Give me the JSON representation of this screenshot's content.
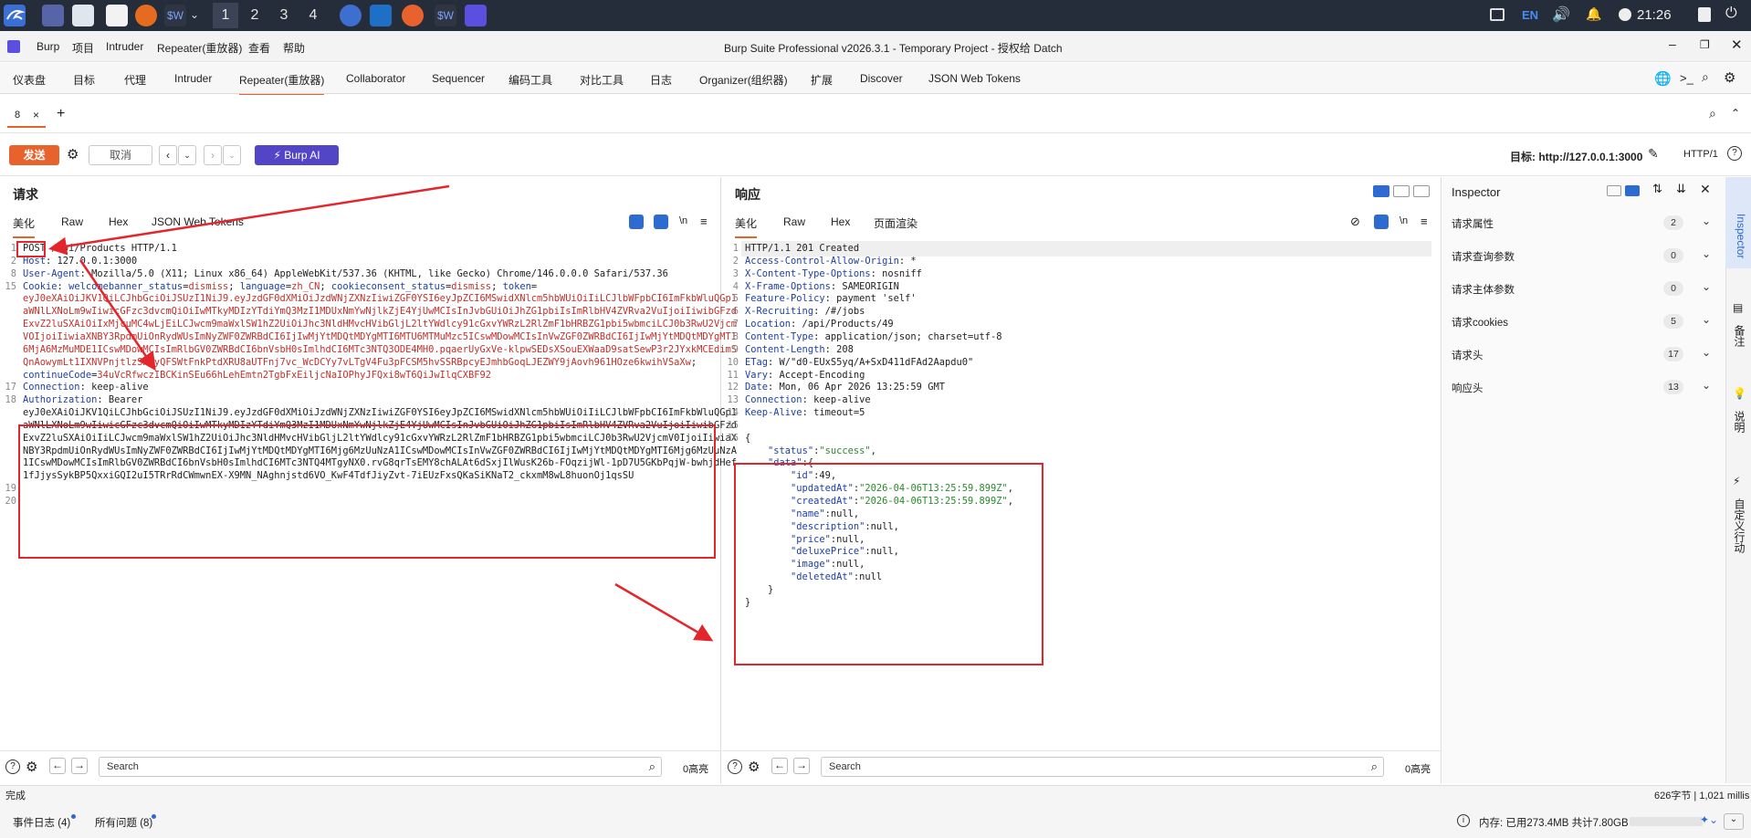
{
  "taskbar": {
    "workspaces": [
      "1",
      "2",
      "3",
      "4"
    ],
    "tray": {
      "lang": "EN",
      "clock": "21:26"
    }
  },
  "app": {
    "menu": [
      "Burp",
      "项目",
      "Intruder",
      "Repeater(重放器)",
      "查看",
      "帮助"
    ],
    "title": "Burp Suite Professional v2026.3.1 - Temporary Project - 授权给 Datch"
  },
  "main_tabs": [
    "仪表盘",
    "目标",
    "代理",
    "Intruder",
    "Repeater(重放器)",
    "Collaborator",
    "Sequencer",
    "编码工具",
    "对比工具",
    "日志",
    "Organizer(组织器)",
    "扩展",
    "Discover",
    "JSON Web Tokens"
  ],
  "sub_tab": {
    "label": "8",
    "close": "×",
    "add": "+"
  },
  "toolbar": {
    "send": "发送",
    "cancel": "取消",
    "burp_ai": "Burp AI",
    "target_label": "目标: http://127.0.0.1:3000",
    "http_version": "HTTP/1"
  },
  "request": {
    "title": "请求",
    "tabs": [
      "美化",
      "Raw",
      "Hex",
      "JSON Web Tokens"
    ],
    "newline_btn": "\\n",
    "lines": [
      {
        "n": "1",
        "segs": [
          [
            "v",
            "POST /api/Products HTTP/1.1"
          ]
        ]
      },
      {
        "n": "2",
        "segs": [
          [
            "k",
            "Host"
          ],
          [
            "v",
            ": 127.0.0.1:3000"
          ]
        ]
      },
      {
        "n": "8",
        "segs": [
          [
            "k",
            "User-Agent"
          ],
          [
            "v",
            ": Mozilla/5.0 (X11; Linux x86_64) AppleWebKit/537.36 (KHTML, like Gecko) Chrome/146.0.0.0 Safari/537.36"
          ]
        ]
      },
      {
        "n": "15",
        "segs": [
          [
            "k",
            "Cookie"
          ],
          [
            "v",
            ": "
          ],
          [
            "blue",
            "welcomebanner_status"
          ],
          [
            "v",
            "="
          ],
          [
            "red",
            "dismiss"
          ],
          [
            "v",
            "; "
          ],
          [
            "blue",
            "language"
          ],
          [
            "v",
            "="
          ],
          [
            "red",
            "zh_CN"
          ],
          [
            "v",
            "; "
          ],
          [
            "blue",
            "cookieconsent_status"
          ],
          [
            "v",
            "="
          ],
          [
            "red",
            "dismiss"
          ],
          [
            "v",
            "; "
          ],
          [
            "blue",
            "token"
          ],
          [
            "v",
            "="
          ]
        ]
      },
      {
        "n": "",
        "segs": [
          [
            "red",
            "eyJ0eXAiOiJKV1QiLCJhbGciOiJSUzI1NiJ9.eyJzdGF0dXMiOiJzdWNjZXNzIiwiZGF0YSI6eyJpZCI6MSwidXNlcm5hbWUiOiIiLCJlbWFpbCI6ImFkbWluQGp1"
          ]
        ]
      },
      {
        "n": "",
        "segs": [
          [
            "red",
            "aWNlLXNoLm9wIiwicGFzc3dvcmQiOiIwMTkyMDIzYTdiYmQ3MzI1MDUxNmYwNjlkZjE4YjUwMCIsInJvbGUiOiJhZG1pbiIsImRlbHV4ZVRva2VuIjoiIiwibGFzd"
          ]
        ]
      },
      {
        "n": "",
        "segs": [
          [
            "red",
            "ExvZ2luSXAiOiIxMjcuMC4wLjEiLCJwcm9maWxlSW1hZ2UiOiJhc3NldHMvcHVibGljL2ltYWdlcy91cGxvYWRzL2RlZmF1bHRBZG1pbi5wbmciLCJ0b3RwU2Vjcm"
          ]
        ]
      },
      {
        "n": "",
        "segs": [
          [
            "red",
            "VOIjoiIiwiaXNBY3RpdmUiOnRydWUsImNyZWF0ZWRBdCI6IjIwMjYtMDQtMDYgMTI6MTU6MTMuMzc5ICswMDowMCIsInVwZGF0ZWRBdCI6IjIwMjYtMDQtMDYgMTI"
          ]
        ]
      },
      {
        "n": "",
        "segs": [
          [
            "red",
            "6MjA6MzMuMDE1ICswMDowMCIsImRlbGV0ZWRBdCI6bnVsbH0sImlhdCI6MTc3NTQ3ODE4MH0.pqaerUyGxVe-klpwSEDsXSouEXWaaD9satSewP3r2JYxkMCEdimS"
          ]
        ]
      },
      {
        "n": "",
        "segs": [
          [
            "red",
            "QnAowymLt1IXNVPnjtlzSKAyQFSWtFnkPtdXRU8aUTFnj7vc_WcDCYy7vLTgV4Fu3pFCSM5hvSSRBpcyEJmhbGoqLJEZWY9jAovh961HOze6kwihVSaXw"
          ],
          [
            "v",
            "; "
          ]
        ]
      },
      {
        "n": "",
        "segs": [
          [
            "blue",
            "continueCode"
          ],
          [
            "v",
            "="
          ],
          [
            "red",
            "34uVcRfwczIBCKinSEu66hLehEmtn2TgbFxEiljcNaIOPhyJFQxi8wT6QiJwIlqCXBF92"
          ]
        ]
      },
      {
        "n": "17",
        "segs": [
          [
            "k",
            "Connection"
          ],
          [
            "v",
            ": keep-alive"
          ]
        ]
      },
      {
        "n": "18",
        "segs": [
          [
            "k",
            "Authorization"
          ],
          [
            "v",
            ": Bearer"
          ]
        ]
      },
      {
        "n": "",
        "segs": [
          [
            "v",
            "eyJ0eXAiOiJKV1QiLCJhbGciOiJSUzI1NiJ9.eyJzdGF0dXMiOiJzdWNjZXNzIiwiZGF0YSI6eyJpZCI6MSwidXNlcm5hbWUiOiIiLCJlbWFpbCI6ImFkbWluQGp1"
          ]
        ]
      },
      {
        "n": "",
        "segs": [
          [
            "v",
            "aWNlLXNoLm9wIiwicGFzc3dvcmQiOiIwMTkyMDIzYTdiYmQ3MzI1MDUxNmYwNjlkZjE4YjUwMCIsInJvbGUiOiJhZG1pbiIsImRlbHV4ZVRva2VuIjoiIiwibGFzd"
          ]
        ]
      },
      {
        "n": "",
        "segs": [
          [
            "v",
            "ExvZ2luSXAiOiIiLCJwcm9maWxlSW1hZ2UiOiJhc3NldHMvcHVibGljL2ltYWdlcy91cGxvYWRzL2RlZmF1bHRBZG1pbi5wbmciLCJ0b3RwU2VjcmV0IjoiIiwiaX"
          ]
        ]
      },
      {
        "n": "",
        "segs": [
          [
            "v",
            "NBY3RpdmUiOnRydWUsImNyZWF0ZWRBdCI6IjIwMjYtMDQtMDYgMTI6Mjg6MzUuNzA1ICswMDowMCIsInVwZGF0ZWRBdCI6IjIwMjYtMDQtMDYgMTI6Mjg6MzUuNzA"
          ]
        ]
      },
      {
        "n": "",
        "segs": [
          [
            "v",
            "1ICswMDowMCIsImRlbGV0ZWRBdCI6bnVsbH0sImlhdCI6MTc3NTQ4MTgyNX0.rvG8qrTsEMY8chALAt6dSxjIlWusK26b-FOqzijWl-1pD7U5GKbPqjW-bwhjdHef"
          ]
        ]
      },
      {
        "n": "",
        "segs": [
          [
            "v",
            "1fJjysSykBP5QxxiGQI2uI5TRrRdCWmwnEX-X9MN_NAghnjstd6VO_KwF4TdfJiyZvt-7iEUzFxsQKaSiKNaT2_ckxmM8wL8huonOj1qsSU"
          ]
        ]
      },
      {
        "n": "19",
        "segs": []
      },
      {
        "n": "20",
        "segs": []
      }
    ],
    "search_placeholder": "Search",
    "highlight_count": "0高亮"
  },
  "response": {
    "title": "响应",
    "tabs": [
      "美化",
      "Raw",
      "Hex",
      "页面渲染"
    ],
    "newline_btn": "\\n",
    "lines": [
      {
        "n": "1",
        "segs": [
          [
            "v",
            "HTTP/1.1 201 Created"
          ]
        ]
      },
      {
        "n": "2",
        "segs": [
          [
            "k",
            "Access-Control-Allow-Origin"
          ],
          [
            "v",
            ": *"
          ]
        ]
      },
      {
        "n": "3",
        "segs": [
          [
            "k",
            "X-Content-Type-Options"
          ],
          [
            "v",
            ": nosniff"
          ]
        ]
      },
      {
        "n": "4",
        "segs": [
          [
            "k",
            "X-Frame-Options"
          ],
          [
            "v",
            ": SAMEORIGIN"
          ]
        ]
      },
      {
        "n": "5",
        "segs": [
          [
            "k",
            "Feature-Policy"
          ],
          [
            "v",
            ": payment 'self'"
          ]
        ]
      },
      {
        "n": "6",
        "segs": [
          [
            "k",
            "X-Recruiting"
          ],
          [
            "v",
            ": /#/jobs"
          ]
        ]
      },
      {
        "n": "7",
        "segs": [
          [
            "k",
            "Location"
          ],
          [
            "v",
            ": /api/Products/49"
          ]
        ]
      },
      {
        "n": "8",
        "segs": [
          [
            "k",
            "Content-Type"
          ],
          [
            "v",
            ": application/json; charset=utf-8"
          ]
        ]
      },
      {
        "n": "9",
        "segs": [
          [
            "k",
            "Content-Length"
          ],
          [
            "v",
            ": 208"
          ]
        ]
      },
      {
        "n": "10",
        "segs": [
          [
            "k",
            "ETag"
          ],
          [
            "v",
            ": W/\"d0-EUxS5yq/A+SxD411dFAd2Aapdu0\""
          ]
        ]
      },
      {
        "n": "11",
        "segs": [
          [
            "k",
            "Vary"
          ],
          [
            "v",
            ": Accept-Encoding"
          ]
        ]
      },
      {
        "n": "12",
        "segs": [
          [
            "k",
            "Date"
          ],
          [
            "v",
            ": Mon, 06 Apr 2026 13:25:59 GMT"
          ]
        ]
      },
      {
        "n": "13",
        "segs": [
          [
            "k",
            "Connection"
          ],
          [
            "v",
            ": keep-alive"
          ]
        ]
      },
      {
        "n": "14",
        "segs": [
          [
            "k",
            "Keep-Alive"
          ],
          [
            "v",
            ": timeout=5"
          ]
        ]
      },
      {
        "n": "15",
        "segs": []
      },
      {
        "n": "16",
        "segs": [
          [
            "v",
            "{"
          ]
        ]
      },
      {
        "n": "",
        "segs": [
          [
            "v",
            "    "
          ],
          [
            "jk",
            "\"status\""
          ],
          [
            "v",
            ":"
          ],
          [
            "jv",
            "\"success\""
          ],
          [
            "v",
            ","
          ]
        ]
      },
      {
        "n": "",
        "segs": [
          [
            "v",
            "    "
          ],
          [
            "jk",
            "\"data\""
          ],
          [
            "v",
            ":{"
          ]
        ]
      },
      {
        "n": "",
        "segs": [
          [
            "v",
            "        "
          ],
          [
            "jk",
            "\"id\""
          ],
          [
            "v",
            ":49,"
          ]
        ]
      },
      {
        "n": "",
        "segs": [
          [
            "v",
            "        "
          ],
          [
            "jk",
            "\"updatedAt\""
          ],
          [
            "v",
            ":"
          ],
          [
            "jv",
            "\"2026-04-06T13:25:59.899Z\""
          ],
          [
            "v",
            ","
          ]
        ]
      },
      {
        "n": "",
        "segs": [
          [
            "v",
            "        "
          ],
          [
            "jk",
            "\"createdAt\""
          ],
          [
            "v",
            ":"
          ],
          [
            "jv",
            "\"2026-04-06T13:25:59.899Z\""
          ],
          [
            "v",
            ","
          ]
        ]
      },
      {
        "n": "",
        "segs": [
          [
            "v",
            "        "
          ],
          [
            "jk",
            "\"name\""
          ],
          [
            "v",
            ":null,"
          ]
        ]
      },
      {
        "n": "",
        "segs": [
          [
            "v",
            "        "
          ],
          [
            "jk",
            "\"description\""
          ],
          [
            "v",
            ":null,"
          ]
        ]
      },
      {
        "n": "",
        "segs": [
          [
            "v",
            "        "
          ],
          [
            "jk",
            "\"price\""
          ],
          [
            "v",
            ":null,"
          ]
        ]
      },
      {
        "n": "",
        "segs": [
          [
            "v",
            "        "
          ],
          [
            "jk",
            "\"deluxePrice\""
          ],
          [
            "v",
            ":null,"
          ]
        ]
      },
      {
        "n": "",
        "segs": [
          [
            "v",
            "        "
          ],
          [
            "jk",
            "\"image\""
          ],
          [
            "v",
            ":null,"
          ]
        ]
      },
      {
        "n": "",
        "segs": [
          [
            "v",
            "        "
          ],
          [
            "jk",
            "\"deletedAt\""
          ],
          [
            "v",
            ":null"
          ]
        ]
      },
      {
        "n": "",
        "segs": [
          [
            "v",
            "    }"
          ]
        ]
      },
      {
        "n": "",
        "segs": [
          [
            "v",
            "}"
          ]
        ]
      }
    ],
    "search_placeholder": "Search",
    "highlight_count": "0高亮"
  },
  "inspector": {
    "title": "Inspector",
    "rows": [
      {
        "label": "请求属性",
        "count": "2"
      },
      {
        "label": "请求查询参数",
        "count": "0"
      },
      {
        "label": "请求主体参数",
        "count": "0"
      },
      {
        "label": "请求cookies",
        "count": "5"
      },
      {
        "label": "请求头",
        "count": "17"
      },
      {
        "label": "响应头",
        "count": "13"
      }
    ],
    "side_tabs": [
      "Inspector",
      "备注",
      "说明",
      "自定义行动"
    ]
  },
  "status": {
    "done": "完成",
    "bytes": "626字节 | 1,021 millis",
    "event_log": "事件日志 (4)",
    "issues": "所有问题 (8)",
    "memory": "内存: 已用273.4MB 共计7.80GB"
  }
}
